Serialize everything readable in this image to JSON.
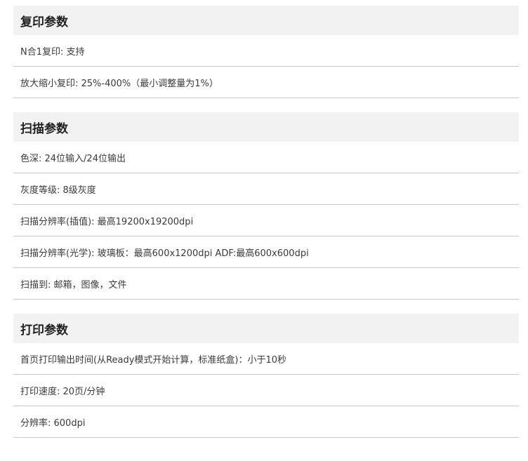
{
  "sections": [
    {
      "title": "复印参数",
      "rows": [
        "N合1复印: 支持",
        "放大缩小复印: 25%-400%（最小调整量为1%）"
      ]
    },
    {
      "title": "扫描参数",
      "rows": [
        "色深: 24位输入/24位输出",
        "灰度等级: 8级灰度",
        "扫描分辨率(插值): 最高19200x19200dpi",
        "扫描分辨率(光学): 玻璃板：最高600x1200dpi ADF:最高600x600dpi",
        "扫描到: 邮箱，图像，文件"
      ]
    },
    {
      "title": "打印参数",
      "rows": [
        "首页打印输出时间(从Ready模式开始计算，标准纸盒)：小于10秒",
        "打印速度: 20页/分钟",
        "分辨率: 600dpi"
      ]
    }
  ]
}
